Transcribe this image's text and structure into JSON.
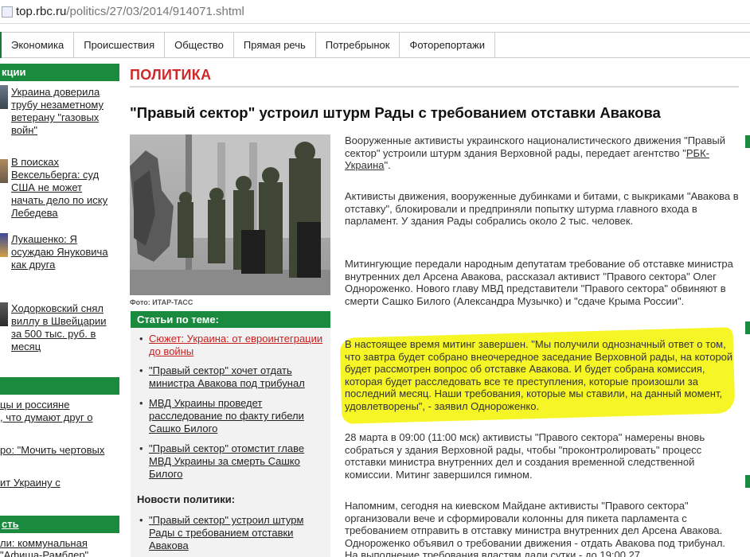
{
  "browser": {
    "url_host": "top.rbc.ru",
    "url_path": "/politics/27/03/2014/914071.shtml"
  },
  "nav": {
    "items": [
      "Экономика",
      "Происшествия",
      "Общество",
      "Прямая речь",
      "Потребрынок",
      "Фоторепортажи"
    ]
  },
  "left": {
    "header": "кции",
    "news": [
      "Украина доверила трубу незаметному ветерану \"газовых войн\"",
      "В поисках Вексельберга: суд США не может начать дело по иску Лебедева",
      "Лукашенко: Я осуждаю Януковича как друга",
      "Ходорковский снял виллу в Швейцарии за 500 тыс. руб. в месяц"
    ],
    "links1": [
      "цы и россияне",
      ", что думают друг о",
      "ро: \"Мочить чертовых",
      "ит Украину с"
    ],
    "header2": "сть",
    "links2": [
      "ли: коммунальная",
      "\"Афиша-Рамблер\""
    ]
  },
  "section": {
    "title": "ПОЛИТИКА"
  },
  "article": {
    "headline": "\"Правый сектор\" устроил штурм Рады с требованием отставки Авакова",
    "photo_caption": "Фото: ИТАР-ТАСС",
    "p1a": "Вооруженные активисты украинского националистического движения \"Правый сектор\" устроили штурм здания Верховной рады, передает агентство \"",
    "p1_link": "РБК-Украина",
    "p1b": "\".",
    "p2": "Активисты движения, вооруженные дубинками и битами, с выкриками \"Авакова в отставку\", блокировали и предприняли попытку штурма главного входа в парламент. У здания Рады собрались около 2 тыс. человек.",
    "p3": "Митингующие передали народным депутатам требование об отставке министра внутренних дел Арсена Авакова, рассказал активист \"Правого сектора\" Олег Однороженко. Нового главу МВД представители \"Правого сектора\" обвиняют в смерти Сашко Билого (Александра Музычко) и \"сдаче Крыма России\".",
    "p4": "В настоящее время митинг завершен. \"Мы получили однозначный ответ о том, что завтра будет собрано внеочередное заседание Верховной рады, на которой будет рассмотрен вопрос об отставке Авакова. И будет собрана комиссия, которая будет расследовать все те преступления, которые произошли за последний месяц. Наши требования, которые мы ставили, на данный момент, удовлетворены\", - заявил Однороженко.",
    "p5": "28 марта в 09:00 (11:00 мск) активисты \"Правого сектора\" намерены вновь собраться у здания Верховной рады, чтобы \"проконтролировать\" процесс отставки министра внутренних дел и создания временной следственной комиссии. Митинг завершился гимном.",
    "p6": "Напомним, сегодня на киевском Майдане активисты \"Правого сектора\" организовали вече и сформировали колонны для пикета парламента с требованием отправить в отставку министра внутренних дел Арсена Авакова. Однороженко объявил о требовании движения - отдать Авакова под трибунал. На выполнение требования властям дали сутки - до 19:00 27"
  },
  "related": {
    "header": "Статьи по теме:",
    "items": [
      "Сюжет: Украина: от евроинтеграции до войны",
      "\"Правый сектор\" хочет отдать министра Авакова под трибунал",
      "МВД Украины проведет расследование по факту гибели Сашко Билого",
      "\"Правый сектор\" отомстит главе МВД Украины за смерть Сашко Билого"
    ],
    "sub_header": "Новости политики:",
    "news": [
      "\"Правый сектор\" устроил штурм Рады с требованием отставки Авакова"
    ]
  },
  "colors": {
    "brand_green": "#1a8a3e",
    "section_red": "#d0282a",
    "highlight": "#f5f51a"
  }
}
